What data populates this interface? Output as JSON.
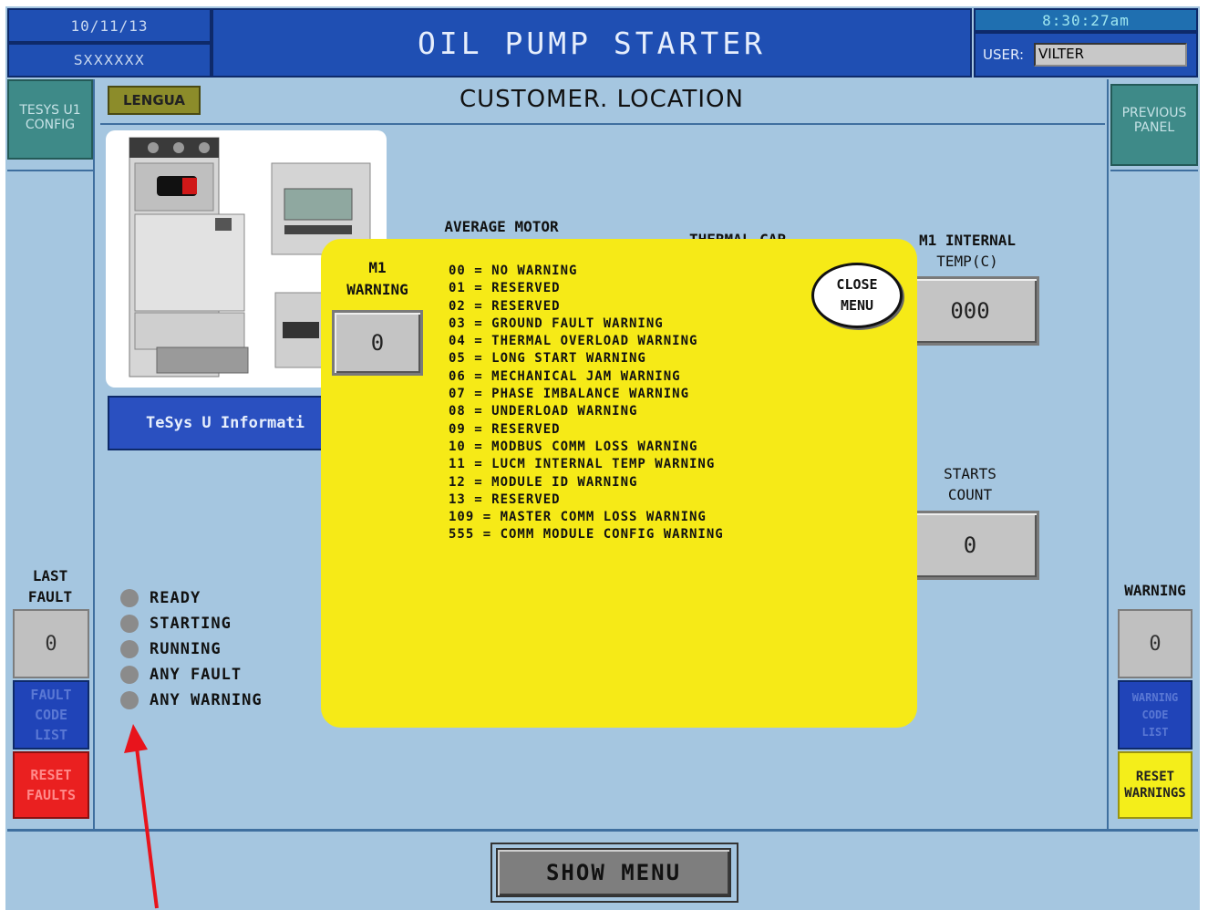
{
  "header": {
    "date": "10/11/13",
    "serial": "SXXXXXX",
    "title": "OIL PUMP STARTER",
    "time": "8:30:27am",
    "user_label": "USER:",
    "user_value": "VILTER"
  },
  "nav": {
    "tesys_config": [
      "TESYS U1",
      "CONFIG"
    ],
    "previous_panel": [
      "PREVIOUS",
      "PANEL"
    ],
    "lengua": "LENGUA"
  },
  "location_title": "CUSTOMER. LOCATION",
  "tesys_info_button": "TeSys U Informati",
  "readouts": {
    "avg_motor_label": "AVERAGE MOTOR",
    "thermal_cap_label": "THERMAL CAP",
    "internal_temp_label": [
      "M1 INTERNAL",
      "TEMP(C)"
    ],
    "internal_temp_value": "000",
    "starts_count_label": [
      "STARTS",
      "COUNT"
    ],
    "starts_count_value": "0"
  },
  "left_panel": {
    "last_fault_label": [
      "LAST",
      "FAULT"
    ],
    "last_fault_value": "0",
    "fault_code_list": [
      "FAULT",
      "CODE",
      "LIST"
    ],
    "reset_faults": [
      "RESET",
      "FAULTS"
    ]
  },
  "right_panel": {
    "warning_label": "WARNING",
    "warning_value": "0",
    "warning_code_list": [
      "WARNING",
      "CODE",
      "LIST"
    ],
    "reset_warnings": [
      "RESET",
      "WARNINGS"
    ]
  },
  "status_lamps": [
    "READY",
    "STARTING",
    "RUNNING",
    "ANY FAULT",
    "ANY WARNING"
  ],
  "popup": {
    "m1_label": [
      "M1",
      "WARNING"
    ],
    "m1_value": "0",
    "close_menu": [
      "CLOSE",
      "MENU"
    ],
    "codes": [
      "00 = NO WARNING",
      "01 = RESERVED",
      "02 = RESERVED",
      "03 = GROUND FAULT WARNING",
      "04 = THERMAL OVERLOAD WARNING",
      "05 = LONG START WARNING",
      "06 = MECHANICAL JAM WARNING",
      "07 = PHASE IMBALANCE WARNING",
      "08 = UNDERLOAD WARNING",
      "09 = RESERVED",
      "10 = MODBUS COMM LOSS WARNING",
      "11 = LUCM INTERNAL TEMP WARNING",
      "12 = MODULE ID WARNING",
      "13 = RESERVED",
      "109 = MASTER COMM LOSS WARNING",
      "555 = COMM MODULE CONFIG WARNING"
    ]
  },
  "show_menu": "SHOW MENU",
  "colors": {
    "background": "#a5c6e0",
    "header_blue": "#1f4fb3",
    "popup_yellow": "#f6ea17",
    "reset_red": "#ea2020",
    "reset_yellow": "#f4ee1a",
    "annotation_arrow": "#e8141c"
  }
}
